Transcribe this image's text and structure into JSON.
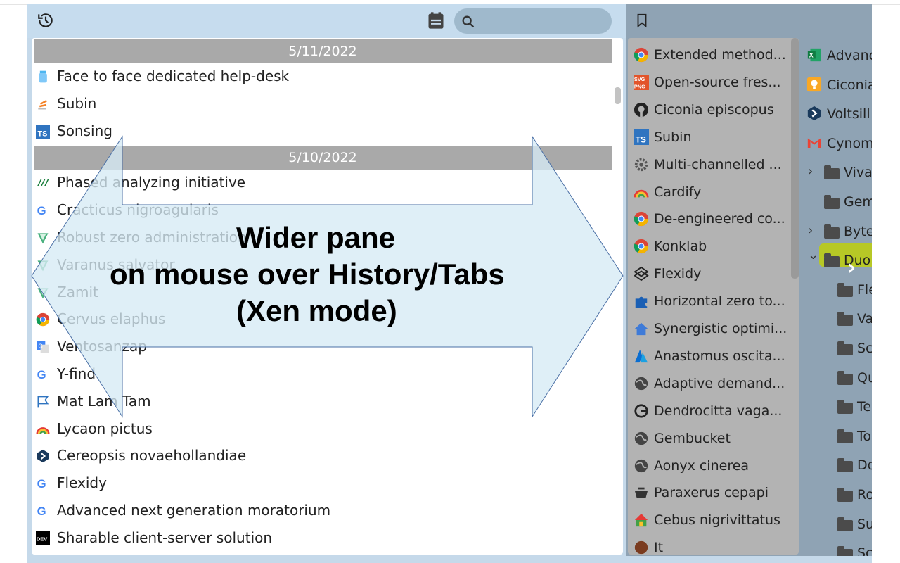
{
  "history": {
    "groups": [
      {
        "date": "5/11/2022",
        "items": [
          {
            "title": "Face to face dedicated help-desk",
            "icon": "jar-icon"
          },
          {
            "title": "Subin",
            "icon": "stackoverflow-icon"
          },
          {
            "title": "Sonsing",
            "icon": "ts-icon"
          }
        ]
      },
      {
        "date": "5/10/2022",
        "items": [
          {
            "title": "Phased analyzing initiative",
            "icon": "green-logo-icon"
          },
          {
            "title": "Cracticus nigroagularis",
            "icon": "google-icon"
          },
          {
            "title": "Robust zero administration",
            "icon": "shield-icon"
          },
          {
            "title": "Varanus salvator",
            "icon": "shield-icon"
          },
          {
            "title": "Zamit",
            "icon": "shield-icon"
          },
          {
            "title": "Cervus elaphus",
            "icon": "chrome-icon"
          },
          {
            "title": "Ventosanzap",
            "icon": "translate-icon"
          },
          {
            "title": "Y-find",
            "icon": "google-icon"
          },
          {
            "title": "Mat Lam Tam",
            "icon": "flag-icon"
          },
          {
            "title": "Lycaon pictus",
            "icon": "rainbow-icon"
          },
          {
            "title": "Cereopsis novaehollandiae",
            "icon": "hexagon-icon"
          },
          {
            "title": "Flexidy",
            "icon": "google-icon"
          },
          {
            "title": "Advanced next generation moratorium",
            "icon": "google-icon"
          },
          {
            "title": "Sharable client-server solution",
            "icon": "dev-icon"
          }
        ]
      }
    ]
  },
  "tabs": [
    {
      "title": "Extended method...",
      "icon": "chrome-icon"
    },
    {
      "title": "Open-source fres...",
      "icon": "svg-png-icon"
    },
    {
      "title": "Ciconia episcopus",
      "icon": "github-icon"
    },
    {
      "title": "Subin",
      "icon": "ts-icon"
    },
    {
      "title": "Multi-channelled ...",
      "icon": "gear-icon"
    },
    {
      "title": "Cardify",
      "icon": "rainbow-icon"
    },
    {
      "title": "De-engineered co...",
      "icon": "chrome-icon"
    },
    {
      "title": "Konklab",
      "icon": "chrome-icon"
    },
    {
      "title": "Flexidy",
      "icon": "codepen-icon"
    },
    {
      "title": "Horizontal zero to...",
      "icon": "puzzle-icon"
    },
    {
      "title": "Synergistic optimi...",
      "icon": "home-icon"
    },
    {
      "title": "Anastomus oscita...",
      "icon": "azure-icon"
    },
    {
      "title": "Adaptive demand...",
      "icon": "globe-icon"
    },
    {
      "title": "Dendrocitta vaga...",
      "icon": "grafana-icon"
    },
    {
      "title": "Gembucket",
      "icon": "globe-icon"
    },
    {
      "title": "Aonyx cinerea",
      "icon": "globe-icon"
    },
    {
      "title": "Paraxerus cepapi",
      "icon": "pot-icon"
    },
    {
      "title": "Cebus nigrivittatus",
      "icon": "house-colorful-icon"
    },
    {
      "title": "It",
      "icon": "brown-circle-icon"
    }
  ],
  "bookmarks": [
    {
      "title": "Advanc",
      "icon": "excel-icon"
    },
    {
      "title": "Ciconia",
      "icon": "bulb-icon"
    },
    {
      "title": "Voltsill",
      "icon": "hexagon-icon"
    },
    {
      "title": "Cynom",
      "icon": "gmail-icon"
    },
    {
      "title": "Viva",
      "folder": true,
      "chevron": "›"
    },
    {
      "title": "Gem",
      "folder": true
    },
    {
      "title": "Byte",
      "folder": true,
      "chevron": "›"
    },
    {
      "title": "Duo",
      "folder": true,
      "chevron": "⌄",
      "open": true
    },
    {
      "title": "Fle",
      "folder": true,
      "sub": true
    },
    {
      "title": "Va",
      "folder": true,
      "sub": true
    },
    {
      "title": "Sc",
      "folder": true,
      "sub": true
    },
    {
      "title": "Qu",
      "folder": true,
      "sub": true
    },
    {
      "title": "Te",
      "folder": true,
      "sub": true
    },
    {
      "title": "To",
      "folder": true,
      "sub": true
    },
    {
      "title": "Do",
      "folder": true,
      "sub": true
    },
    {
      "title": "Ro",
      "folder": true,
      "sub": true
    },
    {
      "title": "Su",
      "folder": true,
      "sub": true
    },
    {
      "title": "Sc",
      "folder": true,
      "sub": true
    }
  ],
  "overlay": {
    "line1": "Wider pane",
    "line2": "on mouse over History/Tabs",
    "line3": "(Xen mode)"
  },
  "colors": {
    "header_bg": "#c6dcee",
    "date_bar": "#a9a9a9",
    "tabs_bg": "#b3b3b3",
    "highlight": "#b7c826",
    "arrow_fill": "#d6ebf5"
  }
}
